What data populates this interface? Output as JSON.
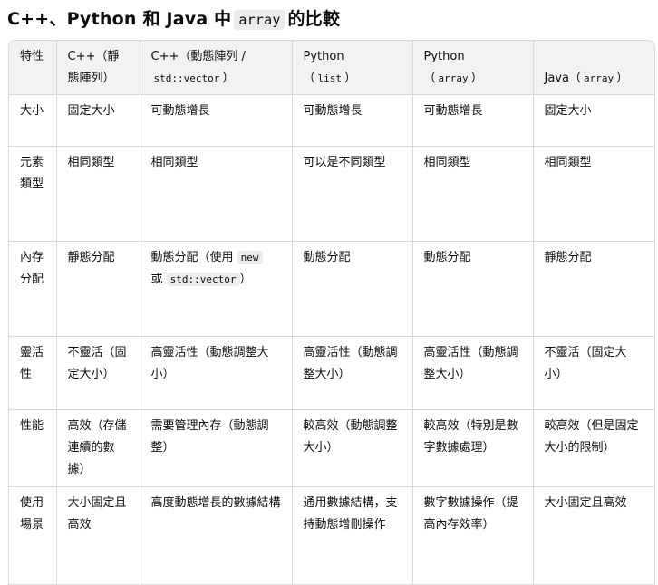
{
  "title": {
    "prefix": "C++、Python 和 Java 中",
    "code": "array",
    "suffix": "的比較"
  },
  "headers": {
    "feature": "特性",
    "cpp_static": "C++（靜態陣列）",
    "cpp_dynamic_text": "C++（動態陣列 /",
    "cpp_dynamic_code": "std::vector",
    "cpp_dynamic_close": "）",
    "py_list_name": "Python",
    "py_list_open": "（",
    "py_list_code": "list",
    "py_list_close": "）",
    "py_array_name": "Python",
    "py_array_open": "（",
    "py_array_code": "array",
    "py_array_close": "）",
    "java_name": "Java（",
    "java_code": "array",
    "java_close": "）"
  },
  "rows": [
    {
      "feature": "大小",
      "cpp_static": "固定大小",
      "cpp_dynamic": "可動態增長",
      "py_list": "可動態增長",
      "py_array": "可動態增長",
      "java": "固定大小"
    },
    {
      "feature": "元素類型",
      "cpp_static": "相同類型",
      "cpp_dynamic": "相同類型",
      "py_list": "可以是不同類型",
      "py_array": "相同類型",
      "java": "相同類型"
    },
    {
      "feature": "內存分配",
      "cpp_static": "靜態分配",
      "cpp_dynamic_parts": {
        "text1": "動態分配（使用",
        "code1": "new",
        "text2": "或",
        "code2": "std::vector",
        "text3": "）"
      },
      "py_list": "動態分配",
      "py_array": "動態分配",
      "java": "靜態分配"
    },
    {
      "feature": "靈活性",
      "cpp_static": "不靈活（固定大小）",
      "cpp_dynamic": "高靈活性（動態調整大小）",
      "py_list": "高靈活性（動態調整大小）",
      "py_array": "高靈活性（動態調整大小）",
      "java": "不靈活（固定大小）"
    },
    {
      "feature": "性能",
      "cpp_static": "高效（存儲連續的數據）",
      "cpp_dynamic": "需要管理內存（動態調整）",
      "py_list": "較高效（動態調整大小）",
      "py_array": "較高效（特別是數字數據處理）",
      "java": "較高效（但是固定大小的限制）"
    },
    {
      "feature": "使用場景",
      "cpp_static": "大小固定且高效",
      "cpp_dynamic": "高度動態增長的數據結構",
      "py_list": "通用數據結構，支持動態增刪操作",
      "py_array": "數字數據操作（提高內存效率）",
      "java": "大小固定且高效"
    }
  ]
}
